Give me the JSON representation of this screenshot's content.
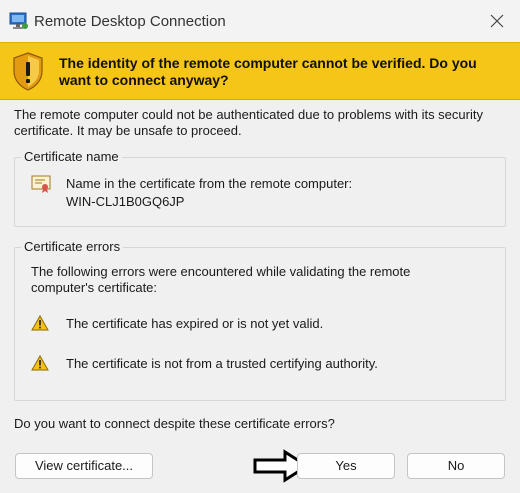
{
  "window": {
    "title": "Remote Desktop Connection",
    "app_icon": "remote-desktop-icon",
    "close_icon": "close-icon"
  },
  "banner": {
    "icon": "shield-warning-icon",
    "text": "The identity of the remote computer cannot be verified. Do you want to connect anyway?",
    "color": "#f5c518"
  },
  "intro": "The remote computer could not be authenticated due to problems with its security certificate. It may be unsafe to proceed.",
  "certificate_group": {
    "label": "Certificate name",
    "icon": "certificate-icon",
    "line1": "Name in the certificate from the remote computer:",
    "line2": "WIN-CLJ1B0GQ6JP"
  },
  "errors_group": {
    "label": "Certificate errors",
    "intro": "The following errors were encountered while validating the remote computer's certificate:",
    "items": [
      {
        "icon": "warning-icon",
        "text": "The certificate has expired or is not yet valid."
      },
      {
        "icon": "warning-icon",
        "text": "The certificate is not from a trusted certifying authority."
      }
    ]
  },
  "question": "Do you want to connect despite these certificate errors?",
  "buttons": {
    "view": "View certificate...",
    "yes": "Yes",
    "no": "No"
  },
  "annotation": {
    "icon": "arrow-right-icon"
  }
}
